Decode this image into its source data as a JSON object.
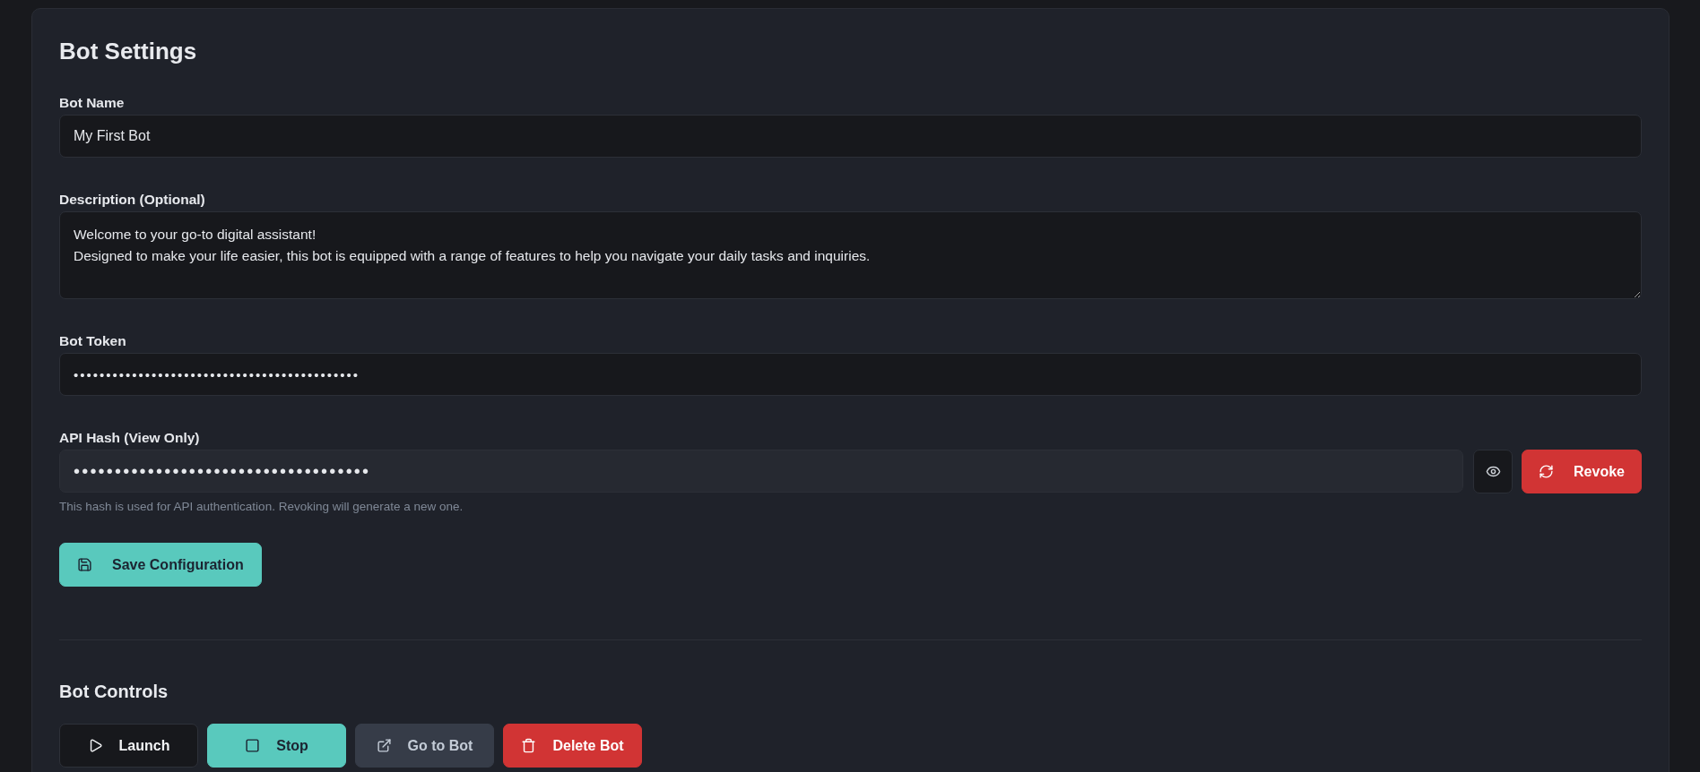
{
  "settings": {
    "title": "Bot Settings",
    "fields": [
      {
        "kind": "text",
        "label": "Bot Name",
        "value": "My First Bot"
      },
      {
        "kind": "textarea",
        "label": "Description (Optional)",
        "lines": [
          "Welcome to your go-to digital assistant!",
          "Designed to make your life easier, this bot is equipped with a range of features to help you navigate your daily tasks and inquiries."
        ]
      },
      {
        "kind": "secret",
        "label": "Bot Token",
        "value": "••••••••••••••••••••••••••••••••••••••••••••"
      },
      {
        "kind": "hash",
        "label": "API Hash (View Only)",
        "value": "••••••••••••••••••••••••••••••••••••",
        "hint": "This hash is used for API authentication. Revoking will generate a new one.",
        "revoke_label": "Revoke"
      }
    ],
    "save_label": "Save Configuration"
  },
  "controls": {
    "title": "Bot Controls",
    "buttons": [
      {
        "kind": "launch",
        "label": "Launch"
      },
      {
        "kind": "stop",
        "label": "Stop"
      },
      {
        "kind": "open",
        "label": "Go to Bot"
      },
      {
        "kind": "delete",
        "label": "Delete Bot"
      }
    ]
  }
}
